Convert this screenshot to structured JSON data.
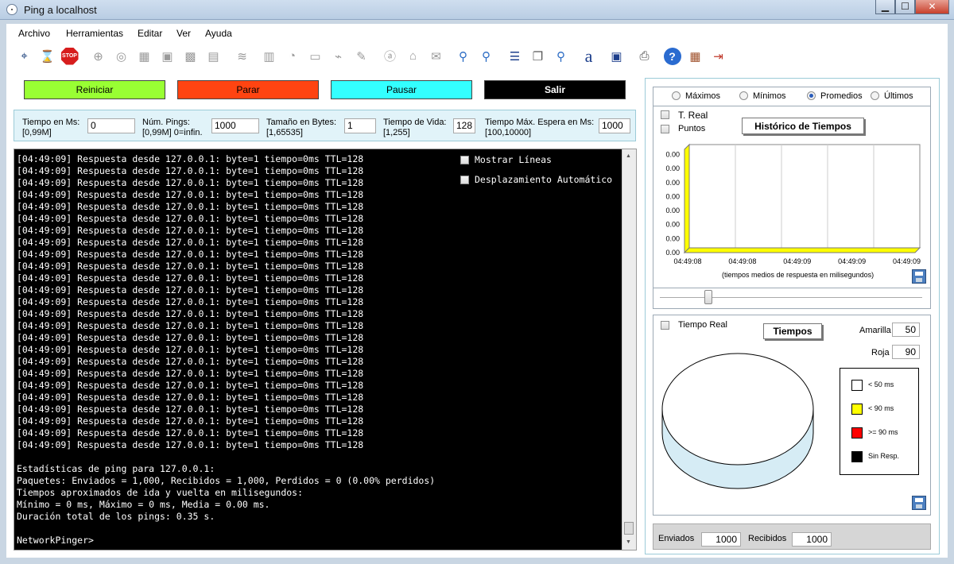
{
  "window": {
    "title": "Ping a localhost"
  },
  "menu": [
    "Archivo",
    "Herramientas",
    "Editar",
    "Ver",
    "Ayuda"
  ],
  "toolbar_icons": [
    "target-icon",
    "hourglass-icon",
    "stop-icon",
    "crosshair-icon",
    "magnifier-globe-icon",
    "chip-icon",
    "image-icon",
    "grid-icon",
    "chart-icon",
    "wave-icon",
    "network-icon",
    "radar-icon",
    "monitor-icon",
    "plug-icon",
    "cable-icon",
    "amazon-icon",
    "bank-icon",
    "mail-icon",
    "zoom-in-icon",
    "zoom-out-icon",
    "server-icon",
    "copy-icon",
    "find-icon",
    "font-icon",
    "save-icon",
    "print-icon",
    "help-icon",
    "wall-icon",
    "exit-icon"
  ],
  "buttons": {
    "restart": "Reiniciar",
    "stop": "Parar",
    "pause": "Pausar",
    "exit": "Salir"
  },
  "params": {
    "time": {
      "label1": "Tiempo en Ms:",
      "label2": "[0,99M]",
      "value": "0"
    },
    "pings": {
      "label1": "Núm. Pings:",
      "label2": "[0,99M] 0=infin.",
      "value": "1000"
    },
    "size": {
      "label1": "Tamaño en Bytes:",
      "label2": "[1,65535]",
      "value": "1"
    },
    "ttl": {
      "label1": "Tiempo de Vida:",
      "label2": "[1,255]",
      "value": "128"
    },
    "timeout": {
      "label1": "Tiempo Máx. Espera en Ms:",
      "label2": "[100,10000]",
      "value": "1000"
    }
  },
  "console": {
    "reply_line": "[04:49:09] Respuesta desde 127.0.0.1: byte=1 tiempo=0ms TTL=128",
    "reply_count": 25,
    "stats": [
      "Estadísticas de ping para 127.0.0.1:",
      "Paquetes: Enviados = 1,000, Recibidos = 1,000, Perdidos = 0 (0.00% perdidos)",
      "Tiempos aproximados de ida y vuelta en milisegundos:",
      "Mínimo = 0 ms, Máximo = 0 ms, Media = 0.00 ms.",
      "Duración total de los pings: 0.35 s."
    ],
    "prompt": "NetworkPinger>",
    "show_lines": "Mostrar Líneas",
    "auto_scroll": "Desplazamiento Automático"
  },
  "history": {
    "modes": [
      "Máximos",
      "Mínimos",
      "Promedios",
      "Últimos"
    ],
    "selected_mode": "Promedios",
    "realtime": "T. Real",
    "points": "Puntos",
    "title": "Histórico de Tiempos",
    "caption": "(tiempos medios de respuesta en milisegundos)",
    "slider_value": 0.17
  },
  "chart_data": {
    "type": "area",
    "title": "Histórico de Tiempos",
    "xlabel": "(tiempos medios de respuesta en milisegundos)",
    "ylabel": "",
    "x": [
      "04:49:08",
      "04:49:08",
      "04:49:09",
      "04:49:09",
      "04:49:09"
    ],
    "y_ticks": [
      "0.00",
      "0.00",
      "0.00",
      "0.00",
      "0.00",
      "0.00",
      "0.00",
      "0.00"
    ],
    "series": [
      {
        "values": [
          0,
          0,
          0,
          0,
          0
        ]
      }
    ],
    "colors": {
      "fill": "#ffff00"
    },
    "grid": true
  },
  "times": {
    "realtime": "Tiempo Real",
    "title": "Tiempos",
    "yellow_label": "Amarilla",
    "yellow_value": "50",
    "red_label": "Roja",
    "red_value": "90",
    "legend": [
      {
        "label": "< 50 ms",
        "color": "#ffffff"
      },
      {
        "label": "< 90 ms",
        "color": "#ffff00"
      },
      {
        "label": ">= 90 ms",
        "color": "#ff0000"
      },
      {
        "label": "Sin Resp.",
        "color": "#000000"
      }
    ]
  },
  "counters": {
    "sent_label": "Enviados",
    "sent_value": "1000",
    "received_label": "Recibidos",
    "received_value": "1000"
  },
  "colors": {
    "restart": "#99ff33",
    "stop": "#ff4411",
    "pause": "#33ffff",
    "exit": "#000000"
  }
}
